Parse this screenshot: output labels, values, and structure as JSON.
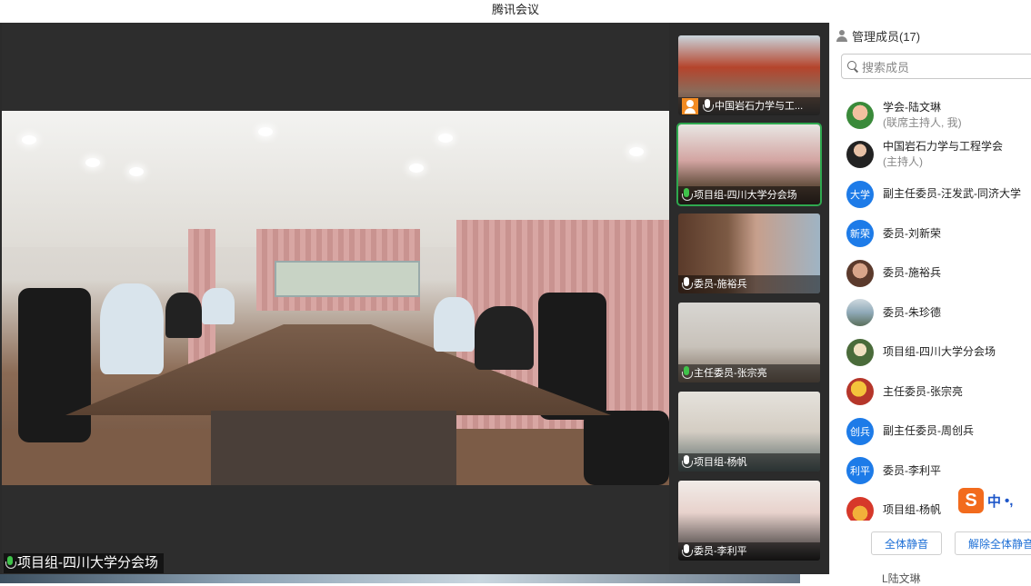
{
  "window": {
    "title": "腾讯会议"
  },
  "main_video": {
    "speaker_label": "项目组-四川大学分会场"
  },
  "thumbnails": [
    {
      "label": "中国岩石力学与工...",
      "host": true,
      "active": false
    },
    {
      "label": "项目组-四川大学分会场",
      "host": false,
      "active": true
    },
    {
      "label": "委员-施裕兵",
      "host": false,
      "active": false
    },
    {
      "label": "主任委员-张宗亮",
      "host": false,
      "active": false
    },
    {
      "label": "项目组-杨帆",
      "host": false,
      "active": false,
      "muted": true
    },
    {
      "label": "委员-李利平",
      "host": false,
      "active": false,
      "muted": true
    }
  ],
  "panel": {
    "header": "管理成员(17)",
    "search_placeholder": "搜索成员",
    "members": [
      {
        "name": "学会-陆文琳",
        "sub": "(联席主持人, 我)",
        "avatar": "photo"
      },
      {
        "name": "中国岩石力学与工程学会",
        "sub": "(主持人)",
        "avatar": "photo"
      },
      {
        "name": "副主任委员-汪发武-同济大学",
        "avatar_text": "大学"
      },
      {
        "name": "委员-刘新荣",
        "avatar_text": "新荣"
      },
      {
        "name": "委员-施裕兵",
        "avatar": "photo"
      },
      {
        "name": "委员-朱珍德",
        "avatar": "photo"
      },
      {
        "name": "项目组-四川大学分会场",
        "avatar": "photo"
      },
      {
        "name": "主任委员-张宗亮",
        "avatar": "photo"
      },
      {
        "name": "副主任委员-周创兵",
        "avatar_text": "创兵"
      },
      {
        "name": "委员-李利平",
        "avatar_text": "利平"
      },
      {
        "name": "项目组-杨帆",
        "avatar": "photo"
      }
    ],
    "mute_all": "全体静音",
    "unmute_all": "解除全体静音"
  },
  "ime": {
    "logo": "S",
    "mode": "中",
    "punct": "•,"
  },
  "taskbar": {
    "text": "L陆文琳"
  }
}
